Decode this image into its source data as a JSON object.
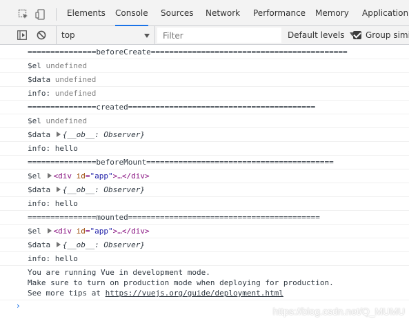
{
  "tabs": [
    {
      "label": "Elements",
      "active": false
    },
    {
      "label": "Console",
      "active": true
    },
    {
      "label": "Sources",
      "active": false
    },
    {
      "label": "Network",
      "active": false
    },
    {
      "label": "Performance",
      "active": false
    },
    {
      "label": "Memory",
      "active": false
    },
    {
      "label": "Application",
      "active": false
    }
  ],
  "toolbar": {
    "context": "top",
    "filter_placeholder": "Filter",
    "levels": "Default levels",
    "group_similar": "Group similar",
    "group_similar_checked": true
  },
  "console": {
    "lines": [
      {
        "type": "plain",
        "text": "===============beforeCreate==========================================="
      },
      {
        "type": "undef",
        "label": "$el",
        "value": "undefined"
      },
      {
        "type": "undef",
        "label": "$data",
        "value": "undefined"
      },
      {
        "type": "undef",
        "label": "info:",
        "value": "undefined"
      },
      {
        "type": "plain",
        "text": "===============created========================================="
      },
      {
        "type": "undef",
        "label": "$el",
        "value": "undefined"
      },
      {
        "type": "object",
        "label": "$data",
        "value": "{__ob__: Observer}"
      },
      {
        "type": "plain",
        "text": "info: hello"
      },
      {
        "type": "plain",
        "text": "===============beforeMount========================================="
      },
      {
        "type": "element",
        "label": "$el",
        "tag_open": "<div",
        "attr_name": "id",
        "attr_value": "\"app\"",
        "tag_rest": ">…</div>"
      },
      {
        "type": "object",
        "label": "$data",
        "value": "{__ob__: Observer}"
      },
      {
        "type": "plain",
        "text": "info: hello"
      },
      {
        "type": "plain",
        "text": "===============mounted=========================================="
      },
      {
        "type": "element",
        "label": "$el",
        "tag_open": "<div",
        "attr_name": "id",
        "attr_value": "\"app\"",
        "tag_rest": ">…</div>"
      },
      {
        "type": "object",
        "label": "$data",
        "value": "{__ob__: Observer}"
      },
      {
        "type": "plain",
        "text": "info: hello"
      }
    ],
    "vue_notice": {
      "line1": "You are running Vue in development mode.",
      "line2": "Make sure to turn on production mode when deploying for production.",
      "line3_prefix": "See more tips at ",
      "line3_link": "https://vuejs.org/guide/deployment.html"
    },
    "prompt": "›"
  },
  "watermark": "https://blog.csdn.net/Q_MUMU",
  "colors": {
    "accent": "#1a73e8",
    "tag": "#881280",
    "attr": "#994500",
    "attr_value": "#1a1aa6",
    "undefined": "#808080"
  }
}
